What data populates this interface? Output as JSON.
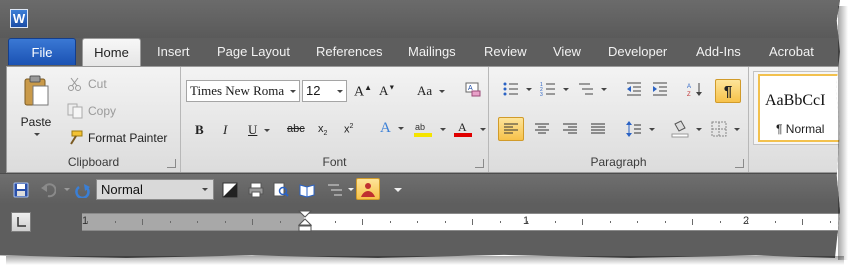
{
  "app": {
    "icon_letter": "W"
  },
  "tabs": [
    "File",
    "Home",
    "Insert",
    "Page Layout",
    "References",
    "Mailings",
    "Review",
    "View",
    "Developer",
    "Add-Ins",
    "Acrobat"
  ],
  "clipboard": {
    "paste": "Paste",
    "cut": "Cut",
    "copy": "Copy",
    "format_painter": "Format Painter",
    "label": "Clipboard"
  },
  "font": {
    "family": "Times New Roma",
    "size": "12",
    "label": "Font",
    "aa": "Aa"
  },
  "paragraph": {
    "label": "Paragraph",
    "pilcrow": "¶"
  },
  "styles": {
    "preview": "AaBbCcI",
    "name": "¶ Normal"
  },
  "qat": {
    "style_value": "Normal"
  },
  "ruler": {
    "numbers": [
      "1",
      "1",
      "2"
    ]
  },
  "colors": {
    "file_tab": "#2a62c4",
    "highlight": "#f5e400",
    "font_color": "#e00000",
    "active_button": "#fbd46a"
  }
}
